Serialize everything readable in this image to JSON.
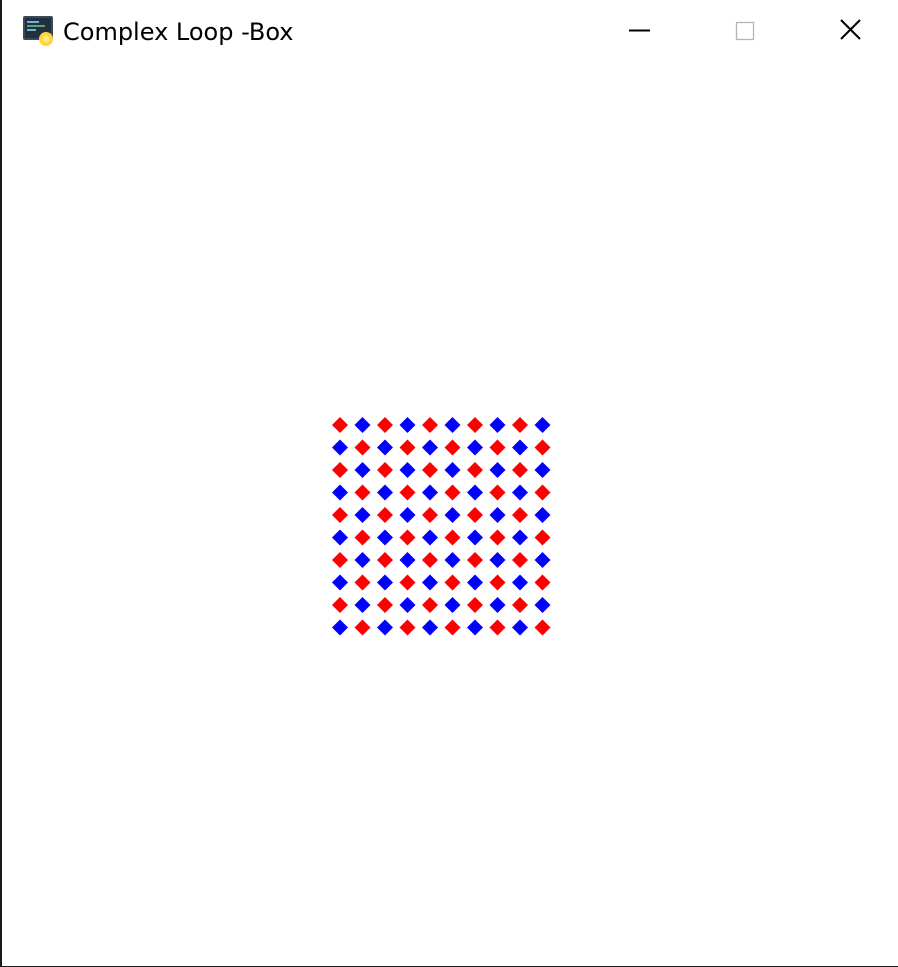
{
  "window": {
    "title": "Complex Loop -Box",
    "app_icon": "python-idle-icon",
    "controls": {
      "minimize_icon": "minimize-icon",
      "maximize_icon": "maximize-icon",
      "close_icon": "close-icon"
    }
  },
  "canvas": {
    "pattern": "checkerboard-diamonds",
    "rows": 10,
    "columns": 10,
    "colors": {
      "first": "#ff0000",
      "second": "#0000ff"
    }
  }
}
